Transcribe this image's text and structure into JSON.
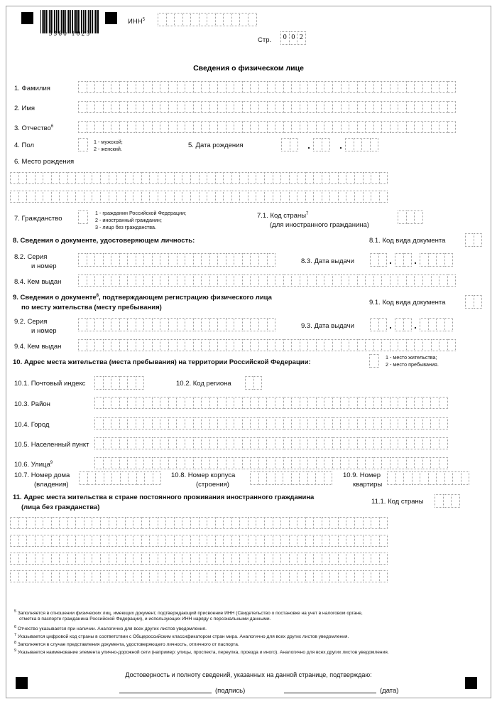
{
  "document": {
    "barcode_digits": "5360 1025",
    "inn_label": "ИНН",
    "inn_footnote": "5",
    "page_label": "Стр.",
    "page_number": "002",
    "title": "Сведения о физическом лице"
  },
  "fields": {
    "f1": "1. Фамилия",
    "f2": "2. Имя",
    "f3": "3. Отчество",
    "f3_note": "6",
    "f4": "4. Пол",
    "f4_opt1": "1 - мужской;",
    "f4_opt2": "2 - женский.",
    "f5": "5. Дата рождения",
    "f6": "6. Место рождения",
    "f7": "7. Гражданство",
    "f7_opt1": "1 - гражданин Российской Федерации;",
    "f7_opt2": "2 - иностранный гражданин;",
    "f7_opt3": "3 - лицо без гражданства.",
    "f71": "7.1. Код страны",
    "f71_note": "7",
    "f71_sub": "(для иностранного гражданина)",
    "f8": "8. Сведения о документе, удостоверяющем личность:",
    "f81": "8.1. Код вида документа",
    "f82_l1": "8.2. Серия",
    "f82_l2": "и номер",
    "f83": "8.3. Дата выдачи",
    "f84": "8.4. Кем выдан",
    "f9_l1": "9. Сведения о документе",
    "f9_note": "8",
    "f9_l1b": ", подтверждающем регистрацию физического лица",
    "f9_l2": "по месту жительства (месту пребывания)",
    "f91": "9.1. Код вида документа",
    "f92_l1": "9.2. Серия",
    "f92_l2": "и номер",
    "f93": "9.3. Дата выдачи",
    "f94": "9.4. Кем выдан",
    "f10": "10. Адрес места жительства (места пребывания) на территории Российской Федерации:",
    "f10_opt1": "1 - место жительства;",
    "f10_opt2": "2 - место пребывания.",
    "f101": "10.1. Почтовый индекс",
    "f102": "10.2. Код региона",
    "f103": "10.3. Район",
    "f104": "10.4. Город",
    "f105": "10.5. Населенный пункт",
    "f106": "10.6. Улица",
    "f106_note": "9",
    "f107_l1": "10.7. Номер дома",
    "f107_l2": "(владения)",
    "f108_l1": "10.8. Номер корпуса",
    "f108_l2": "(строения)",
    "f109_l1": "10.9. Номер",
    "f109_l2": "квартиры",
    "f11_l1": "11. Адрес места жительства в стране постоянного проживания иностранного гражданина",
    "f11_l2": "(лица без гражданства)",
    "f111": "11.1. Код страны"
  },
  "footnotes": [
    {
      "marker": "5",
      "lines": [
        "Заполняется в отношении физических лиц, имеющих документ, подтверждающий присвоение ИНН (Свидетельство о постановке на учет в налоговом органе,",
        "отметка в паспорте гражданина Российской Федерации), и использующих ИНН наряду с персональными данными."
      ]
    },
    {
      "marker": "6",
      "lines": [
        "Отчество указывается при наличии. Аналогично для всех других листов уведомления."
      ]
    },
    {
      "marker": "7",
      "lines": [
        "Указывается цифровой код страны в соответствии с Общероссийским классификатором стран мира. Аналогично для всех других листов уведомления."
      ]
    },
    {
      "marker": "8",
      "lines": [
        "Заполняется в случае представления документа, удостоверяющего личность, отличного от паспорта."
      ]
    },
    {
      "marker": "9",
      "lines": [
        "Указывается наименование элемента улично-дорожной сети (например: улицы, проспекта, переулка, проезда и иного). Аналогично для всех других листов уведомления."
      ]
    }
  ],
  "signature": {
    "statement": "Достоверность и полноту сведений, указанных на данной странице, подтверждаю:",
    "signature_caption": "(подпись)",
    "date_caption": "(дата)"
  }
}
